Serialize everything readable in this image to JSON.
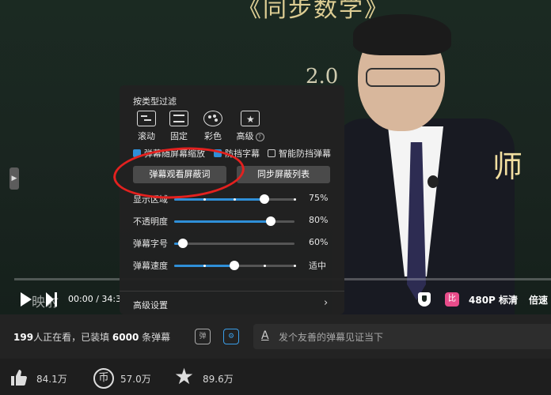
{
  "video": {
    "board_title": "《同步数学》",
    "board_number": "2.0",
    "board_char": "师",
    "watermark": "映射",
    "progress_fraction": 0.0
  },
  "controls": {
    "current_time": "00:00",
    "separator": "/",
    "duration": "34:3",
    "quality": "480P 标清",
    "speed": "倍速",
    "app_badge": "比"
  },
  "danmaku_panel": {
    "filter_title": "按类型过滤",
    "types": [
      {
        "label": "滚动",
        "icon": "scroll-icon"
      },
      {
        "label": "固定",
        "icon": "fixed-icon"
      },
      {
        "label": "彩色",
        "icon": "palette-icon"
      },
      {
        "label": "高级",
        "icon": "advanced-icon"
      }
    ],
    "checkboxes": [
      {
        "label": "弹幕随屏幕缩放",
        "checked": true
      },
      {
        "label": "防挡字幕",
        "checked": true
      },
      {
        "label": "智能防挡弹幕",
        "checked": false
      }
    ],
    "buttons": {
      "blocked_words": "弹幕观看屏蔽词",
      "sync_blocklist": "同步屏蔽列表"
    },
    "sliders": [
      {
        "label": "显示区域",
        "value_text": "75%",
        "fraction": 0.75
      },
      {
        "label": "不透明度",
        "value_text": "80%",
        "fraction": 0.8
      },
      {
        "label": "弹幕字号",
        "value_text": "60%",
        "fraction": 0.07
      },
      {
        "label": "弹幕速度",
        "value_text": "适中",
        "fraction": 0.5
      }
    ],
    "advanced_settings": "高级设置"
  },
  "infobar": {
    "viewers_count": "199",
    "viewers_text": "人正在看，已装填 ",
    "danmaku_count": "6000",
    "danmaku_suffix": " 条弹幕",
    "toggle_icon_text": "弹",
    "input_placeholder": "发个友善的弹幕见证当下",
    "input_value": ""
  },
  "actions": {
    "like_count": "84.1万",
    "coin_count": "57.0万",
    "coin_glyph": "币",
    "favorite_count": "89.6万"
  },
  "colors": {
    "accent": "#2f8fd8",
    "annotation_circle": "#e3211f"
  }
}
